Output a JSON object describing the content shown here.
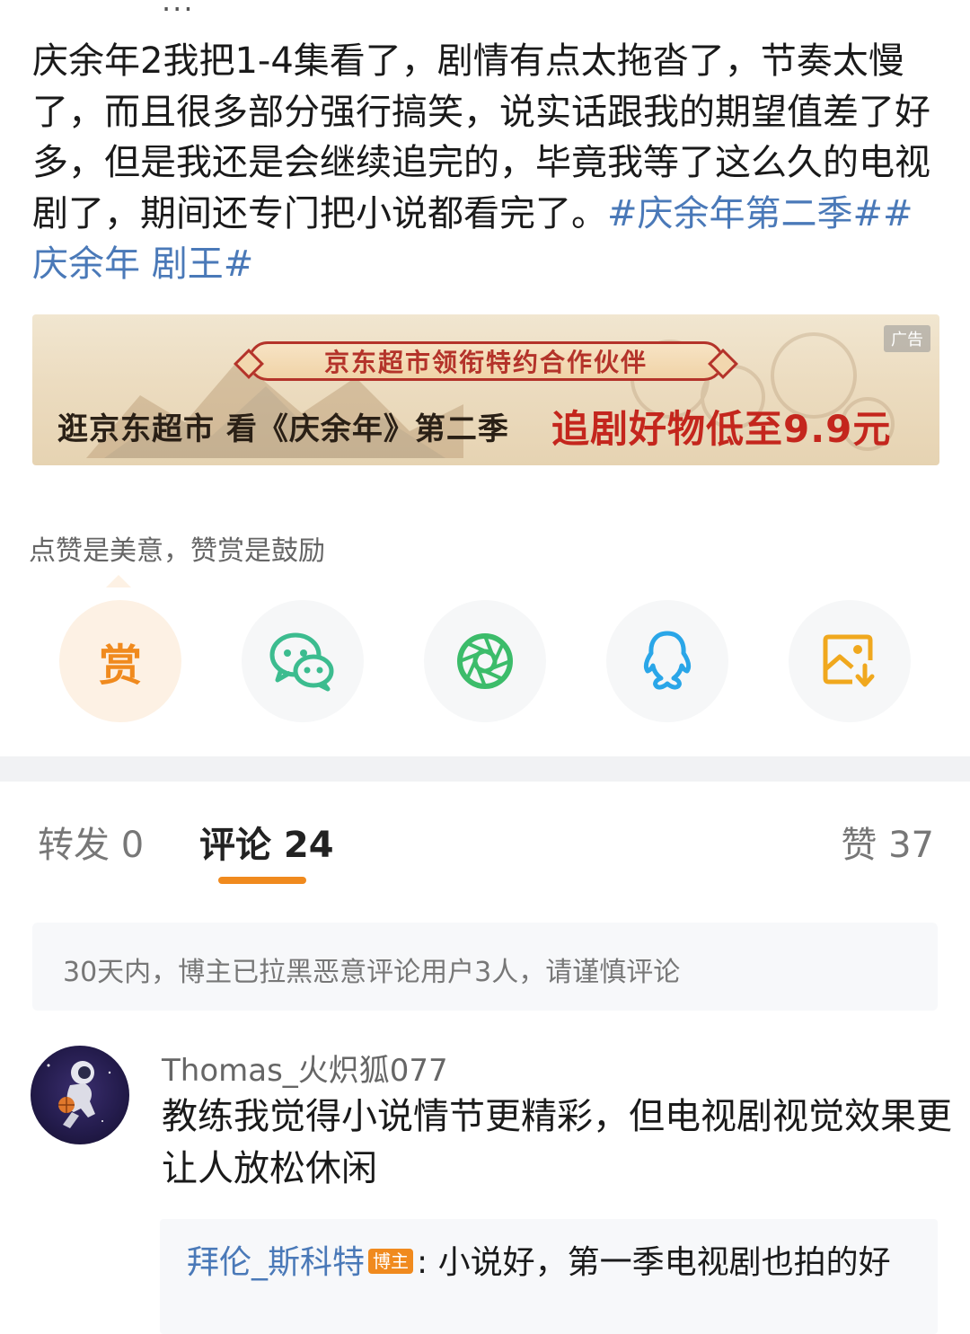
{
  "post": {
    "top_cut_text": "...",
    "body": "庆余年2我把1-4集看了，剧情有点太拖沓了，节奏太慢了，而且很多部分强行搞笑，说实话跟我的期望值差了好多，但是我还是会继续追完的，毕竟我等了这么久的电视剧了，期间还专门把小说都看完了。",
    "tags": "#庆余年第二季##庆余年 剧王#"
  },
  "ad": {
    "badge": "广告",
    "banner": "京东超市领衔特约合作伙伴",
    "line1": "逛京东超市 看《庆余年》第二季",
    "line2": "追剧好物低至9.9元"
  },
  "reward": {
    "hint": "点赞是美意，赞赏是鼓励",
    "reward_label": "赏"
  },
  "share": {
    "icons": [
      "reward-icon",
      "wechat-icon",
      "moments-icon",
      "qq-icon",
      "save-image-icon"
    ],
    "colors": {
      "reward": "#f08a1e",
      "wechat": "#3cbc8f",
      "moments": "#3cbc6a",
      "qq": "#2aa6e8",
      "save": "#f0a81e"
    }
  },
  "tabs": {
    "repost": "转发 0",
    "comment": "评论 24",
    "like": "赞 37"
  },
  "notice": "30天内，博主已拉黑恶意评论用户3人，请谨慎评论",
  "comment": {
    "username": "Thomas_火炽狐077",
    "text": "教练我觉得小说情节更精彩，但电视剧视觉效果更让人放松休闲",
    "reply": {
      "username": "拜伦_斯科特",
      "badge": "博主",
      "separator": ":",
      "text": "小说好，第一季电视剧也拍的好"
    }
  },
  "accent_color": "#f08a1e",
  "link_color": "#4a79b8"
}
